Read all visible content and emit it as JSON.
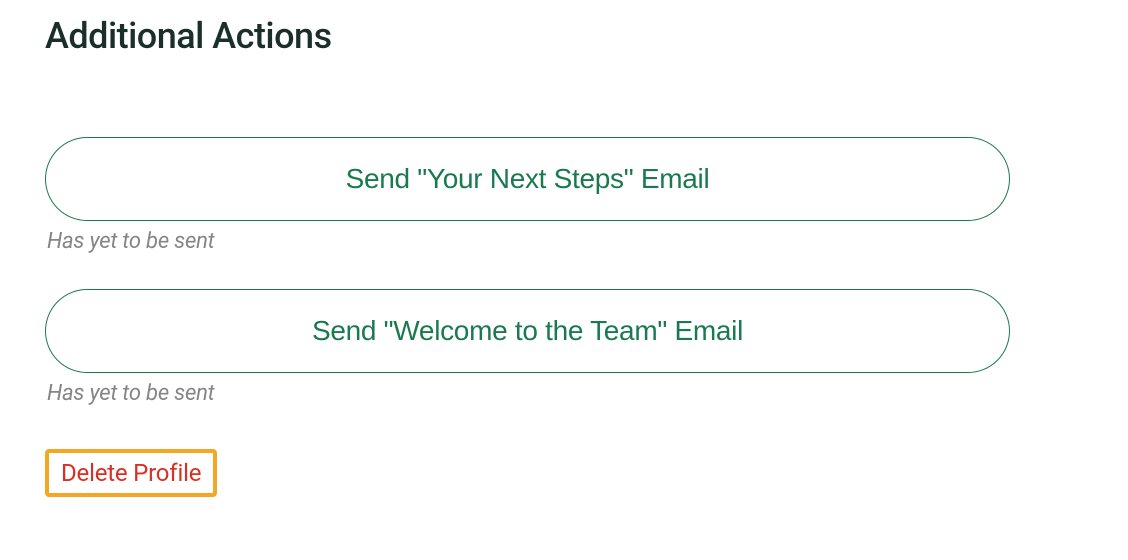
{
  "section": {
    "title": "Additional Actions"
  },
  "actions": {
    "next_steps": {
      "label": "Send \"Your Next Steps\" Email",
      "status": "Has yet to be sent"
    },
    "welcome": {
      "label": "Send \"Welcome to the Team\" Email",
      "status": "Has yet to be sent"
    }
  },
  "delete": {
    "label": "Delete Profile"
  },
  "colors": {
    "button_border": "#1a7a4f",
    "button_text": "#1a7a4f",
    "status_text": "#858585",
    "delete_text": "#d93025",
    "highlight_border": "#f5a623"
  }
}
